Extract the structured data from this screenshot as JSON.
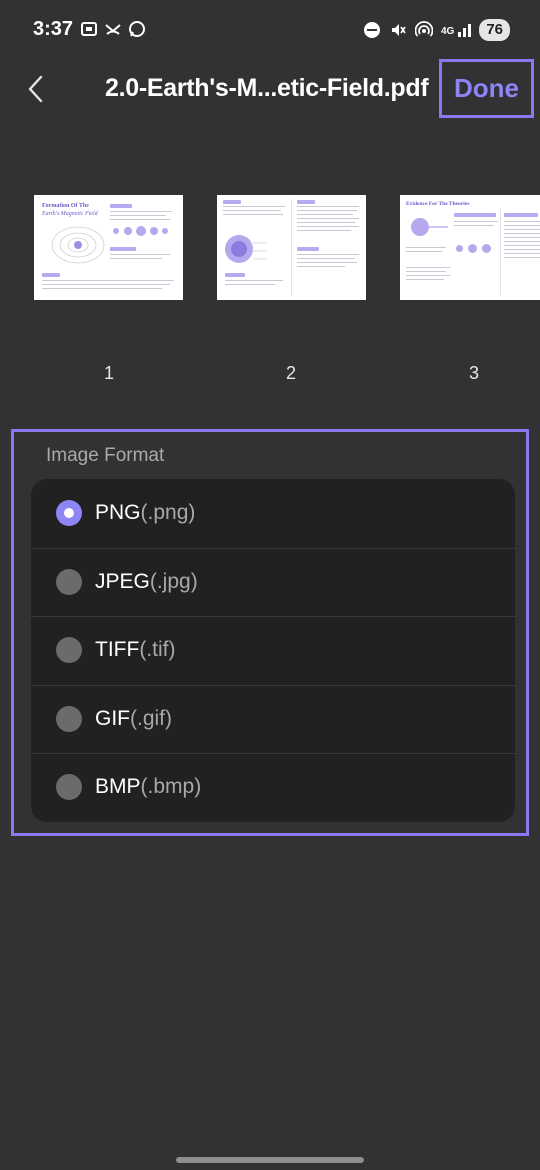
{
  "status_bar": {
    "time": "3:37",
    "left_icons": [
      "screenshot-icon",
      "missed-call-icon",
      "whatsapp-icon"
    ],
    "right_icons": [
      "do-not-disturb-icon",
      "mute-icon",
      "hotspot-icon",
      "4g-signal-icon"
    ],
    "network_label": "4G",
    "battery": "76"
  },
  "topbar": {
    "title": "2.0-Earth's-M...etic-Field.pdf",
    "done_label": "Done"
  },
  "pages": [
    {
      "number": "1",
      "heading": "Formation Of The",
      "subheading": "Earth's Magnetic Field"
    },
    {
      "number": "2"
    },
    {
      "number": "3",
      "heading": "Evidence For The Theories"
    }
  ],
  "format_section": {
    "label": "Image Format",
    "options": [
      {
        "name": "PNG",
        "ext": "(.png)",
        "selected": true
      },
      {
        "name": "JPEG",
        "ext": "(.jpg)",
        "selected": false
      },
      {
        "name": "TIFF",
        "ext": "(.tif)",
        "selected": false
      },
      {
        "name": "GIF",
        "ext": "(.gif)",
        "selected": false
      },
      {
        "name": "BMP",
        "ext": "(.bmp)",
        "selected": false
      }
    ]
  },
  "colors": {
    "background": "#323133",
    "accent": "#8d85f5",
    "highlight_border": "#8b78f0",
    "list_background": "#222122"
  }
}
